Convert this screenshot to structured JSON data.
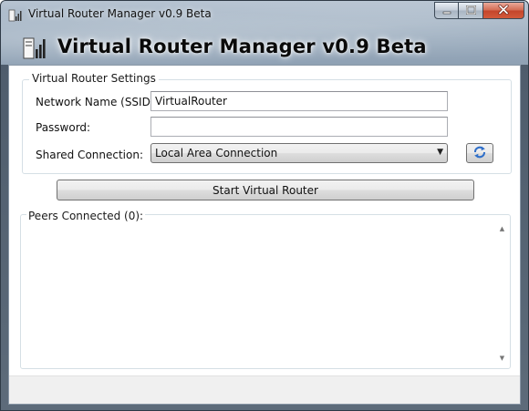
{
  "window": {
    "title": "Virtual Router Manager v0.9 Beta",
    "header_title": "Virtual Router Manager v0.9 Beta",
    "app_icon": "router-signal-icon",
    "caption_buttons": [
      "minimize-icon",
      "maximize-icon",
      "close-icon"
    ]
  },
  "settings": {
    "group_title": "Virtual Router Settings",
    "ssid_label": "Network Name (SSID):",
    "ssid_value": "VirtualRouter",
    "password_label": "Password:",
    "password_value": "",
    "shared_label": "Shared Connection:",
    "shared_value": "Local Area Connection",
    "refresh_icon": "refresh-icon"
  },
  "actions": {
    "start_label": "Start Virtual Router"
  },
  "peers": {
    "group_title": "Peers Connected (0):",
    "items": []
  },
  "colors": {
    "title_glass": "#9fb0c1",
    "button_border": "#707070",
    "close_red": "#c4452b",
    "refresh_blue": "#2f6fc9"
  }
}
